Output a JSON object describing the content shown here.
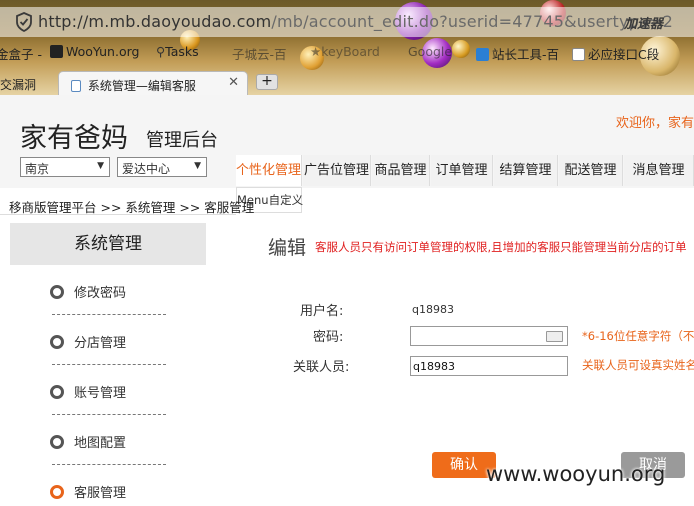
{
  "browser": {
    "url_host": "http://m.mb.daoyoudao.com",
    "url_path": "/mb/account_edit.do?userid=47745&usertype=2",
    "accelerator": "加速器",
    "bookmarks": [
      "金盒子 -",
      "WooYun.org",
      "Tasks",
      "子城云-百",
      "keyBoard",
      "Google",
      "站长工具-百",
      "必应接口C段"
    ],
    "tabs": [
      "交漏洞",
      "系统管理—编辑客服"
    ],
    "new_tab": "+"
  },
  "header": {
    "logo": "家有爸妈",
    "subtitle": "管理后台",
    "welcome": "欢迎你，家有爸",
    "city_select": "南京",
    "center_select": "爱达中心"
  },
  "nav": {
    "items": [
      "个性化管理",
      "广告位管理",
      "商品管理",
      "订单管理",
      "结算管理",
      "配送管理",
      "消息管理"
    ],
    "dropdown_item": "Menu自定义"
  },
  "breadcrumb": "移商版管理平台 >> 系统管理 >> 客服管理",
  "sidebar": {
    "title": "系统管理",
    "items": [
      "修改密码",
      "分店管理",
      "账号管理",
      "地图配置",
      "客服管理"
    ]
  },
  "form": {
    "title": "编辑",
    "note": "客服人员只有访问订单管理的权限,且增加的客服只能管理当前分店的订单",
    "username_label": "用户名:",
    "username_value": "q18983",
    "password_label": "密码:",
    "password_value": "",
    "password_hint": "*6-16位任意字符（不",
    "related_label": "关联人员:",
    "related_value": "q18983",
    "related_hint": "关联人员可设真实姓名",
    "confirm": "确认",
    "cancel": "取消"
  },
  "watermark": "www.wooyun.org"
}
